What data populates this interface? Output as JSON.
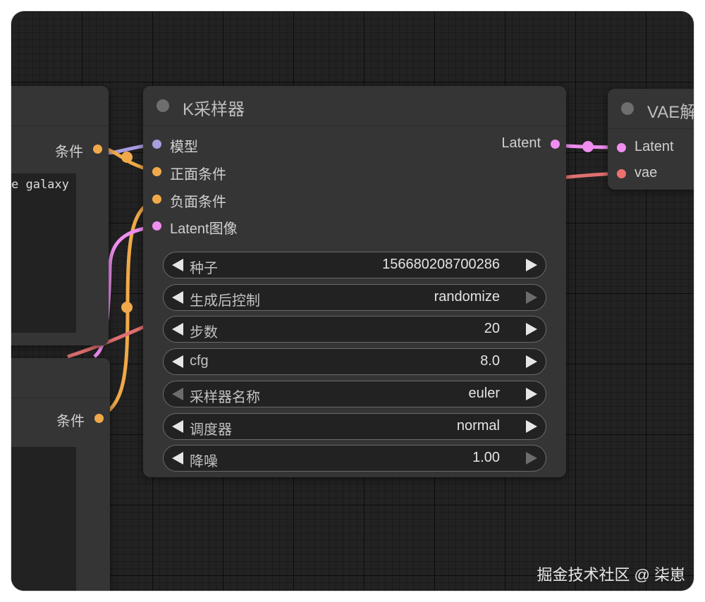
{
  "ksampler": {
    "title": "K采样器",
    "inputs": [
      {
        "label": "模型",
        "color": "#a99ce0"
      },
      {
        "label": "正面条件",
        "color": "#f0a94a"
      },
      {
        "label": "负面条件",
        "color": "#f0a94a"
      },
      {
        "label": "Latent图像",
        "color": "#f08ef0"
      }
    ],
    "output": {
      "label": "Latent",
      "color": "#f08ef0"
    },
    "widgets": [
      {
        "label": "种子",
        "value": "156680208700286",
        "left_enabled": true,
        "right_enabled": true
      },
      {
        "label": "生成后控制",
        "value": "randomize",
        "left_enabled": true,
        "right_enabled": false
      },
      {
        "label": "步数",
        "value": "20",
        "left_enabled": true,
        "right_enabled": true
      },
      {
        "label": "cfg",
        "value": "8.0",
        "left_enabled": true,
        "right_enabled": true
      },
      {
        "label": "采样器名称",
        "value": "euler",
        "left_enabled": false,
        "right_enabled": true
      },
      {
        "label": "调度器",
        "value": "normal",
        "left_enabled": true,
        "right_enabled": true
      },
      {
        "label": "降噪",
        "value": "1.00",
        "left_enabled": true,
        "right_enabled": false
      }
    ]
  },
  "vae_decode": {
    "title": "VAE解",
    "inputs": [
      {
        "label": "Latent",
        "color": "#f08ef0"
      },
      {
        "label": "vae",
        "color": "#ef6f6f"
      }
    ]
  },
  "positive_prompt_node": {
    "output": {
      "label": "条件",
      "color": "#f0a94a"
    },
    "text": "e galaxy"
  },
  "negative_prompt_node": {
    "output": {
      "label": "条件",
      "color": "#f0a94a"
    }
  },
  "link_colors": {
    "model": "#a99ce0",
    "conditioning": "#f0a94a",
    "latent": "#f08ef0",
    "vae": "#e07070"
  },
  "watermark": "掘金技术社区 @ 柒崽"
}
